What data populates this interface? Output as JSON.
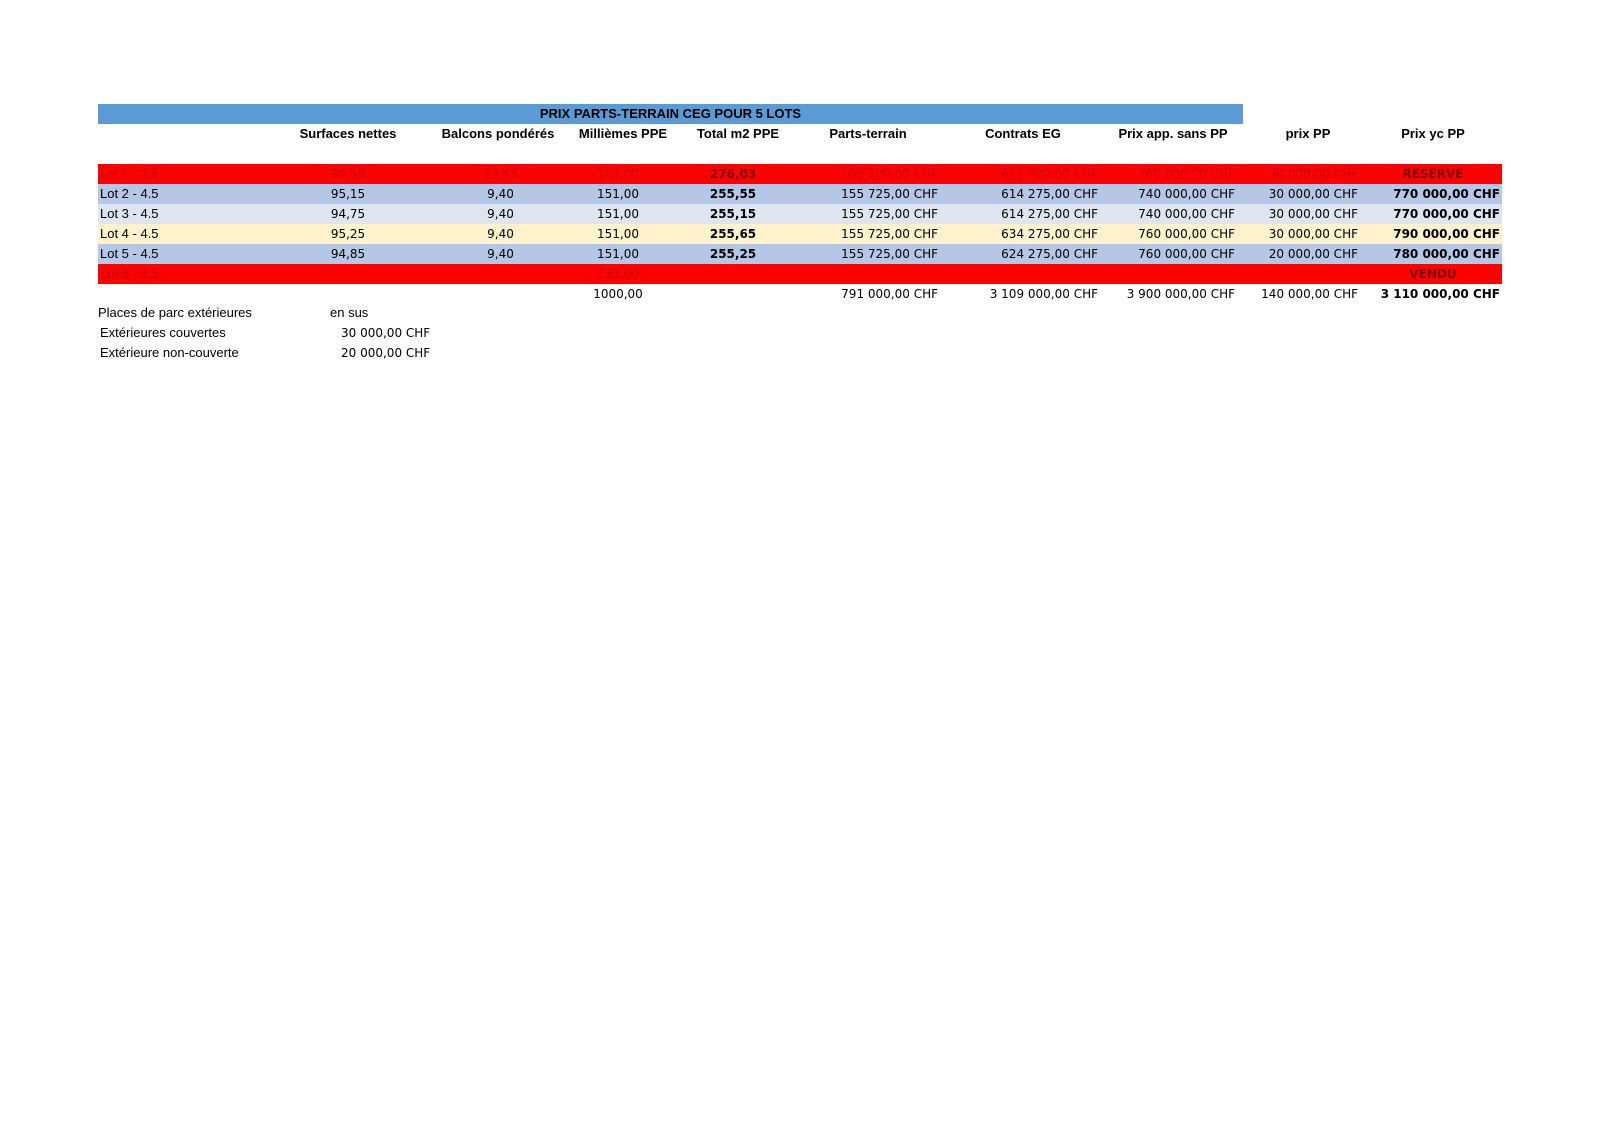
{
  "title": "PRIX PARTS-TERRAIN CEG POUR 5 LOTS",
  "headers": [
    "",
    "Surfaces nettes",
    "Balcons pondérés",
    "Millièmes PPE",
    "Total m2 PPE",
    "Parts-terrain",
    "Contrats EG",
    "Prix app. sans PP",
    "prix PP",
    "Prix yc PP"
  ],
  "rows": [
    {
      "status": "reserve",
      "cells": [
        "Lot 1 - 3.5",
        "99,58",
        "13,45",
        "163,00",
        "276,03",
        "168 100,00 CHF",
        "621 900,00 CHF",
        "760 000,00 CHF",
        "30 000,00 CHF",
        "RESERVE"
      ]
    },
    {
      "status": "normal",
      "cells": [
        "Lot 2 - 4.5",
        "95,15",
        "9,40",
        "151,00",
        "255,55",
        "155 725,00 CHF",
        "614 275,00 CHF",
        "740 000,00 CHF",
        "30 000,00 CHF",
        "770 000,00 CHF"
      ]
    },
    {
      "status": "normal",
      "cells": [
        "Lot 3 - 4.5",
        "94,75",
        "9,40",
        "151,00",
        "255,15",
        "155 725,00 CHF",
        "614 275,00 CHF",
        "740 000,00 CHF",
        "30 000,00 CHF",
        "770 000,00 CHF"
      ]
    },
    {
      "status": "normal",
      "cells": [
        "Lot 4 - 4.5",
        "95,25",
        "9,40",
        "151,00",
        "255,65",
        "155 725,00 CHF",
        "634 275,00 CHF",
        "760 000,00 CHF",
        "30 000,00 CHF",
        "790 000,00 CHF"
      ]
    },
    {
      "status": "normal",
      "cells": [
        "Lot 5 - 4.5",
        "94,85",
        "9,40",
        "151,00",
        "255,25",
        "155 725,00 CHF",
        "624 275,00 CHF",
        "760 000,00 CHF",
        "20 000,00 CHF",
        "780 000,00 CHF"
      ]
    },
    {
      "status": "sold",
      "cells": [
        "Lot 6 - 4.5",
        "",
        "",
        "233,00",
        "",
        "",
        "",
        "",
        "",
        "VENDU"
      ]
    }
  ],
  "totals": [
    "",
    "",
    "",
    "1000,00",
    "",
    "791 000,00 CHF",
    "3 109 000,00 CHF",
    "3 900 000,00 CHF",
    "140 000,00 CHF",
    "3 110 000,00 CHF"
  ],
  "parking": {
    "heading": "Places de parc extérieures",
    "note": "en sus",
    "items": [
      {
        "label": "Extérieures couvertes",
        "price": "30 000,00 CHF"
      },
      {
        "label": "Extérieure non-couverte",
        "price": "20 000,00 CHF"
      }
    ]
  },
  "colors": {
    "title_bar": "#5b9bd5",
    "reserved_row": "#ff0000",
    "row_blue": "#b4c7e7",
    "row_grey": "#dee5f1",
    "row_cream": "#fff2cc"
  }
}
